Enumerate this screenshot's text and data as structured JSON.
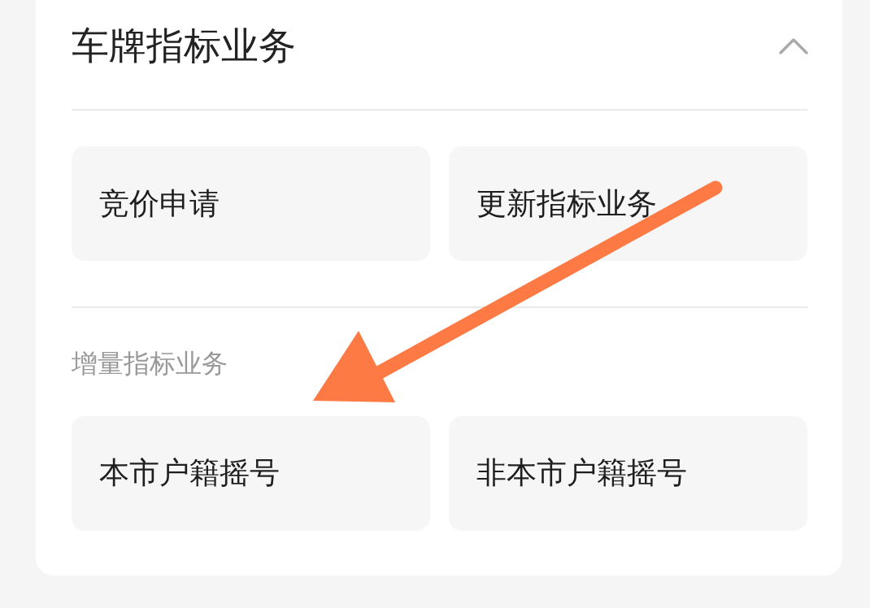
{
  "panel": {
    "title": "车牌指标业务",
    "expanded": true,
    "groups": [
      {
        "items": [
          {
            "label": "竞价申请"
          },
          {
            "label": "更新指标业务"
          }
        ]
      },
      {
        "heading": "增量指标业务",
        "items": [
          {
            "label": "本市户籍摇号"
          },
          {
            "label": "非本市户籍摇号"
          }
        ]
      }
    ]
  }
}
